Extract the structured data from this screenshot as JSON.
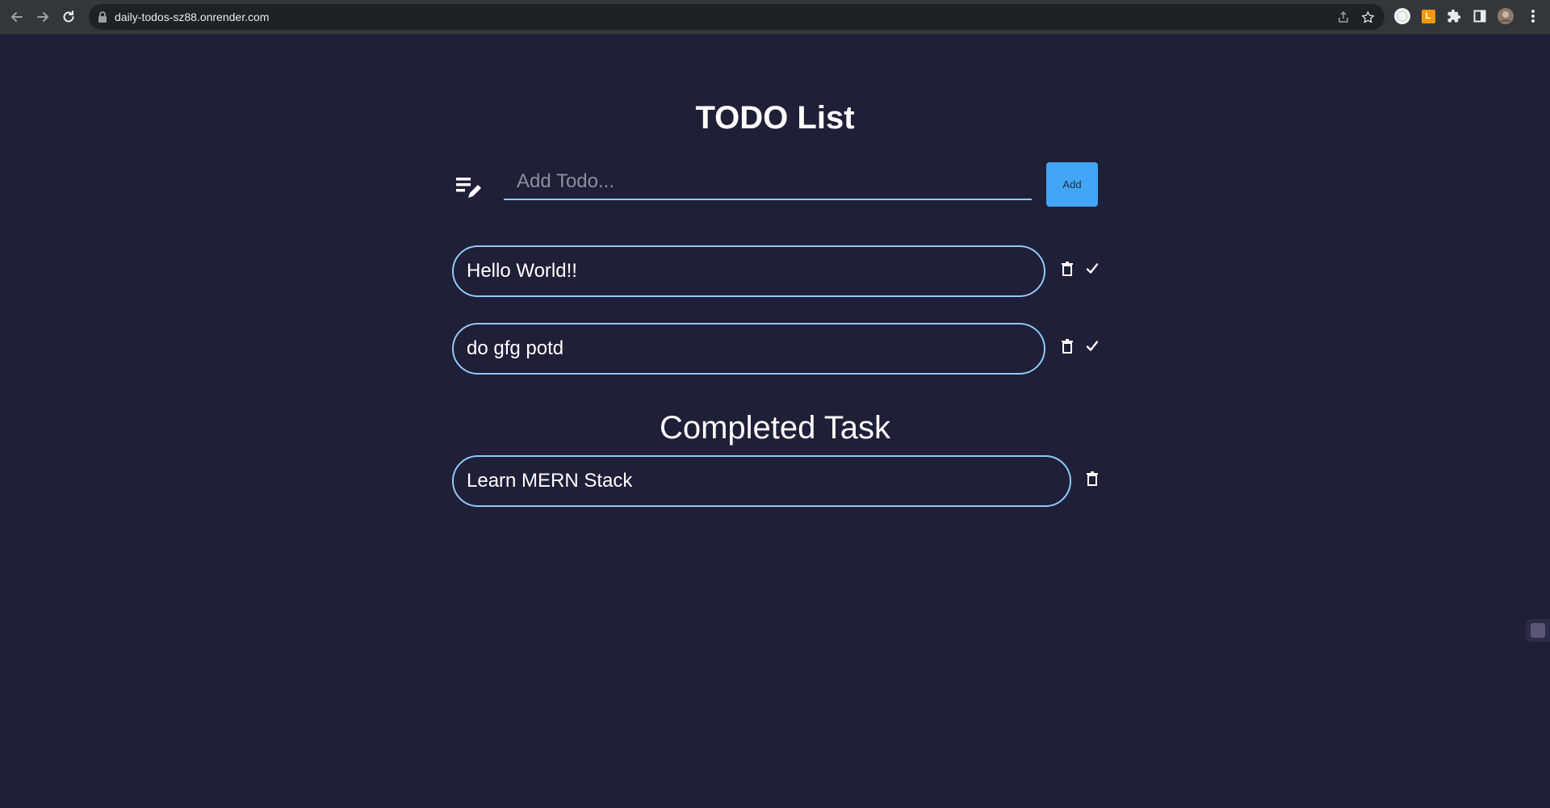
{
  "browser": {
    "url": "daily-todos-sz88.onrender.com",
    "extension_badge": "L"
  },
  "app": {
    "title": "TODO List",
    "input": {
      "placeholder": "Add Todo...",
      "value": ""
    },
    "add_button_label": "Add",
    "todos": [
      {
        "text": "Hello World!!"
      },
      {
        "text": "do gfg potd"
      }
    ],
    "completed_heading": "Completed Task",
    "completed": [
      {
        "text": "Learn MERN Stack"
      }
    ]
  },
  "colors": {
    "background": "#1f1f38",
    "accent": "#90caf9",
    "button": "#42a5f5"
  }
}
